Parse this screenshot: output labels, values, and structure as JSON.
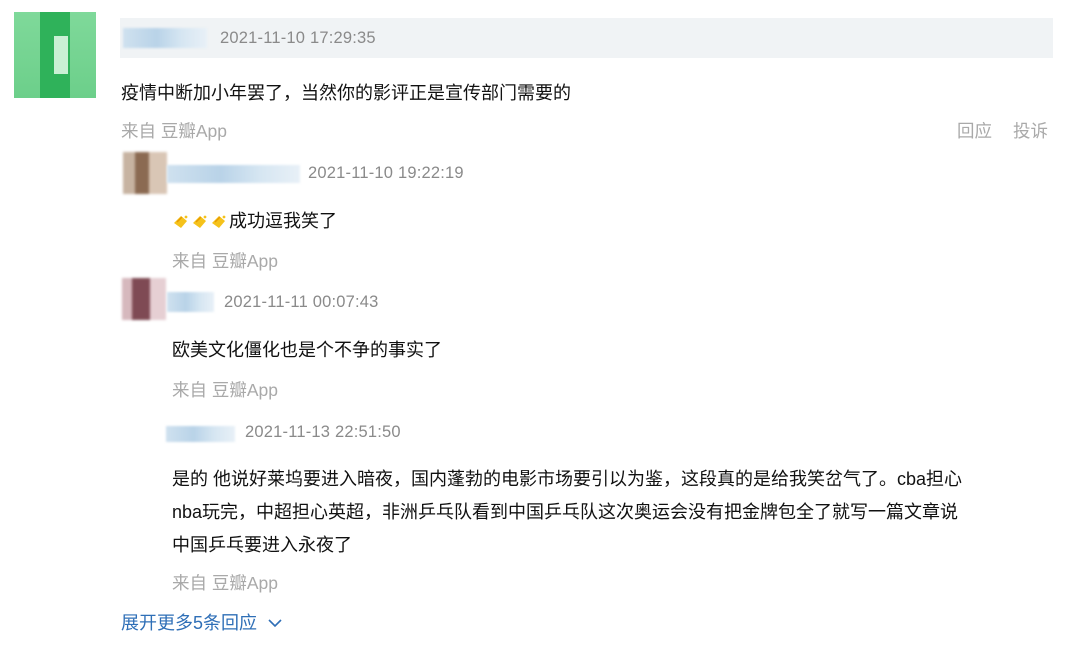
{
  "comment": {
    "time": "2021-11-10 17:29:35",
    "text": "疫情中断加小年罢了，当然你的影评正是宣传部门需要的",
    "source": "来自 豆瓣App",
    "reply_label": "回应",
    "report_label": "投诉"
  },
  "replies": [
    {
      "time": "2021-11-10 19:22:19",
      "text": "成功逗我笑了",
      "prefix_icons": [
        "clapping-hands-icon",
        "clapping-hands-icon",
        "clapping-hands-icon"
      ],
      "source": "来自 豆瓣App"
    },
    {
      "time": "2021-11-11 00:07:43",
      "text": "欧美文化僵化也是个不争的事实了",
      "source": "来自 豆瓣App"
    },
    {
      "time": "2021-11-13 22:51:50",
      "text_lines": [
        "是的 他说好莱坞要进入暗夜，国内蓬勃的电影市场要引以为鉴，这段真的是给我笑岔气了。cba担心",
        "nba玩完，中超担心英超，非洲乒乓队看到中国乒乓队这次奥运会没有把金牌包全了就写一篇文章说",
        "中国乒乓要进入永夜了"
      ],
      "source": "来自 豆瓣App"
    }
  ],
  "expand_label": "展开更多5条回应",
  "colors": {
    "link": "#2f6fb7",
    "muted": "#a9a9a9",
    "time": "#8a8a8a",
    "header_bg": "#f0f3f5"
  }
}
